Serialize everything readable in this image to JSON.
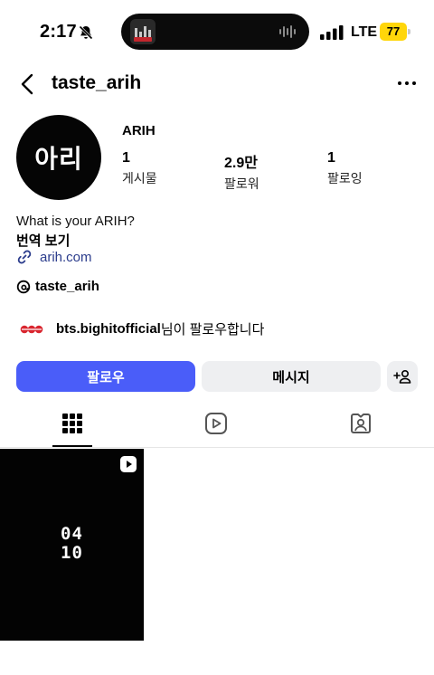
{
  "status_bar": {
    "time": "2:17",
    "network": "LTE",
    "battery": "77",
    "battery_color": "#ffd60a"
  },
  "nav": {
    "username": "taste_arih",
    "back_icon": "chevron-left-icon",
    "more_icon": "more-horizontal-icon"
  },
  "profile": {
    "avatar_text": "아리",
    "display_name": "ARIH",
    "stats": [
      {
        "value": "1",
        "label": "게시물"
      },
      {
        "value": "2.9만",
        "label": "팔로워"
      },
      {
        "value": "1",
        "label": "팔로잉"
      }
    ],
    "bio": "What is your ARIH?",
    "translate": "번역 보기",
    "link": "arih.com",
    "threads_handle": "taste_arih",
    "followed_by_name": "bts.bighitofficial",
    "followed_by_suffix": "님이 팔로우합니다"
  },
  "actions": {
    "follow_label": "팔로우",
    "message_label": "메시지",
    "follow_color": "#4a5df9"
  },
  "tabs": [
    {
      "name": "grid-icon",
      "active": true
    },
    {
      "name": "reels-icon",
      "active": false
    },
    {
      "name": "tagged-icon",
      "active": false
    }
  ],
  "posts": [
    {
      "caption": "04\n10",
      "type": "reel"
    }
  ]
}
